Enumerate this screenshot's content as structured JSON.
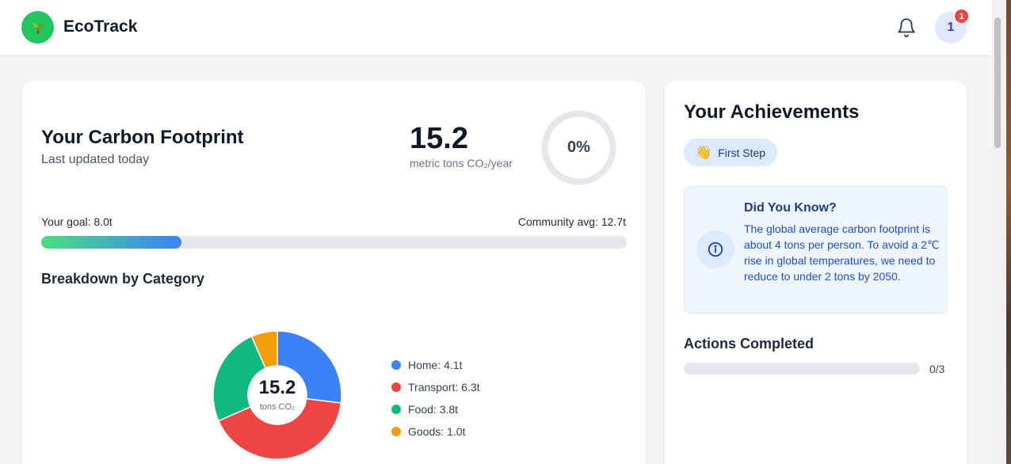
{
  "header": {
    "app_title": "EcoTrack",
    "avatar_initial": "1",
    "notification_count": "1"
  },
  "footprint": {
    "title": "Your Carbon Footprint",
    "updated": "Last updated today",
    "value": "15.2",
    "unit": "metric tons CO₂/year",
    "progress_percent_label": "0%",
    "progress_fraction": 0,
    "goal_label": "Your goal: 8.0t",
    "community_label": "Community avg: 12.7t",
    "goal_bar_fraction": 0.24
  },
  "breakdown": {
    "title": "Breakdown by Category",
    "center_value": "15.2",
    "center_unit": "tons CO₂",
    "categories": [
      {
        "label": "Home: 4.1t",
        "value": 4.1,
        "color": "#3b82f6"
      },
      {
        "label": "Transport: 6.3t",
        "value": 6.3,
        "color": "#ef4444"
      },
      {
        "label": "Food: 3.8t",
        "value": 3.8,
        "color": "#10b981"
      },
      {
        "label": "Goods: 1.0t",
        "value": 1.0,
        "color": "#f59e0b"
      }
    ]
  },
  "achievements": {
    "title": "Your Achievements",
    "badge_emoji": "👋",
    "badge_label": "First Step",
    "info_title": "Did You Know?",
    "info_text": "The global average carbon footprint is about 4 tons per person. To avoid a 2℃ rise in global temperatures, we need to reduce to under 2 tons by 2050.",
    "actions_title": "Actions Completed",
    "actions_count": "0/3",
    "actions_fraction": 0
  },
  "colors": {
    "accent_green": "#22c55e",
    "accent_blue": "#3b82f6",
    "alert_red": "#ef4444"
  },
  "icons": [
    "seedling-icon",
    "bell-icon",
    "info-icon",
    "waving-hand-icon"
  ]
}
